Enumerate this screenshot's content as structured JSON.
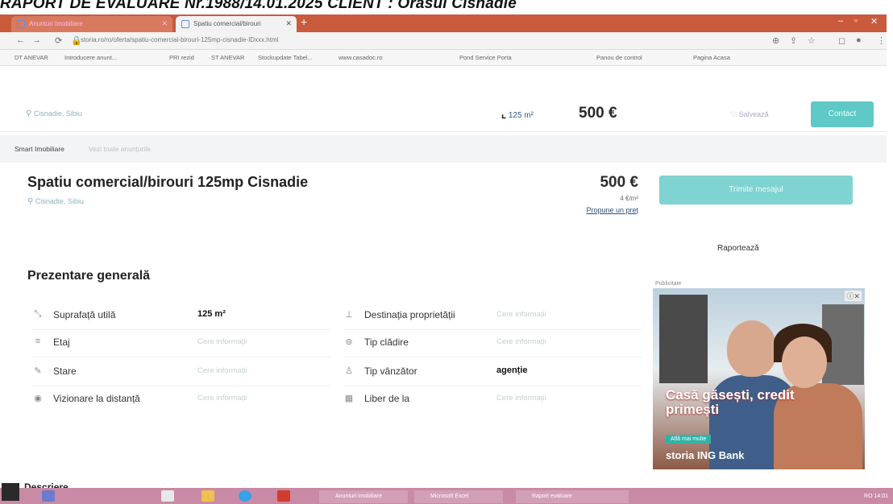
{
  "report_header": "RAPORT DE EVALUARE  Nr.1988/14.01.2025 CLIENT :    Orasul Cisnadie",
  "colors": {
    "accent": "#5ec9c6",
    "tabbar": "#c95a3c",
    "taskbar": "#c98aa6"
  },
  "browser": {
    "tabs": [
      {
        "title": "Anunturi Imobiliare",
        "active": false
      },
      {
        "title": "Spatiu comercial/birouri",
        "active": true
      }
    ],
    "url": "storia.ro/ro/oferta/spatiu-comercial-birouri-125mp-cisnadie-IDxxx.html",
    "bookmarks": [
      "DT ANEVAR",
      "Introducere anunt...",
      "PRI rezid",
      "ST ANEVAR",
      "Stockupdate Tabel...",
      "www.casadoc.ro",
      "Pond Service Porta",
      "Panou de control",
      "Pagina Acasa"
    ]
  },
  "sticky": {
    "location": "Cisnadie, Sibiu",
    "area": "125 m²",
    "price": "500 €",
    "save_label": "Salvează",
    "contact_label": "Contact"
  },
  "breadcrumbs": [
    "Smart Imobiliare",
    "Vezi toate anunțurile"
  ],
  "listing": {
    "title": "Spatiu comercial/birouri 125mp Cisnadie",
    "location": "Cisnadie, Sibiu",
    "price": "500 €",
    "price_per_m2": "4 €/m²",
    "offer_link": "Propune un preț",
    "contact_button": "Trimite mesajul",
    "report_link": "Raportează"
  },
  "overview": {
    "title": "Prezentare generală",
    "left": [
      {
        "icon": "area-icon",
        "label": "Suprafață utilă",
        "value": "125 m²",
        "style": "strong"
      },
      {
        "icon": "floor-icon",
        "label": "Etaj",
        "value": "Cere informații",
        "style": "ask"
      },
      {
        "icon": "condition-icon",
        "label": "Stare",
        "value": "Cere informații",
        "style": "ask"
      },
      {
        "icon": "remote-view-icon",
        "label": "Vizionare la distanță",
        "value": "Cere informații",
        "style": "ask"
      }
    ],
    "right": [
      {
        "icon": "destination-icon",
        "label": "Destinația proprietății",
        "value": "Cere informații",
        "style": "ask"
      },
      {
        "icon": "building-type-icon",
        "label": "Tip clădire",
        "value": "Cere informații",
        "style": "ask"
      },
      {
        "icon": "seller-icon",
        "label": "Tip vânzător",
        "value": "agenție",
        "style": "strong"
      },
      {
        "icon": "calendar-icon",
        "label": "Liber de la",
        "value": "Cere informații",
        "style": "ask"
      }
    ]
  },
  "ad": {
    "label": "Publicitate",
    "headline": "Casă găsești, credit primești",
    "cta": "Află mai multe",
    "brand": "storia  ING Bank"
  },
  "description_title": "Descriere",
  "taskbar": {
    "items": [
      "",
      "",
      "",
      "",
      "",
      "Anunturi imobiliare",
      "Microsoft Excel",
      "Raport evaluare"
    ],
    "tray": "RO  14:01"
  }
}
